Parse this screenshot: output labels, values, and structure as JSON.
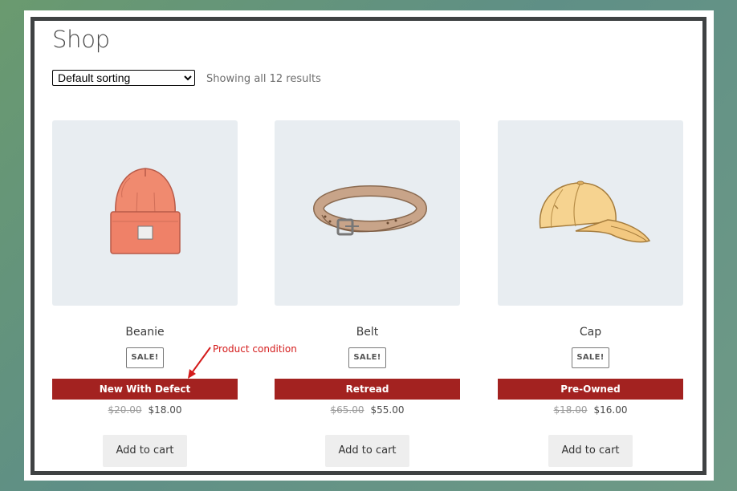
{
  "page": {
    "title": "Shop",
    "sort": {
      "selected": "Default sorting",
      "options": [
        "Default sorting"
      ]
    },
    "result_count": "Showing all 12 results"
  },
  "annotation": {
    "label": "Product condition",
    "color": "#d41b1b"
  },
  "colors": {
    "condition_bar": "#a32220",
    "image_bg": "#e8edf1",
    "frame": "#3f4243"
  },
  "products": [
    {
      "name": "Beanie",
      "image_icon": "beanie-icon",
      "badge": "SALE!",
      "condition": "New With Defect",
      "old_price": "$20.00",
      "price": "$18.00",
      "button": "Add to cart"
    },
    {
      "name": "Belt",
      "image_icon": "belt-icon",
      "badge": "SALE!",
      "condition": "Retread",
      "old_price": "$65.00",
      "price": "$55.00",
      "button": "Add to cart"
    },
    {
      "name": "Cap",
      "image_icon": "cap-icon",
      "badge": "SALE!",
      "condition": "Pre-Owned",
      "old_price": "$18.00",
      "price": "$16.00",
      "button": "Add to cart"
    }
  ]
}
